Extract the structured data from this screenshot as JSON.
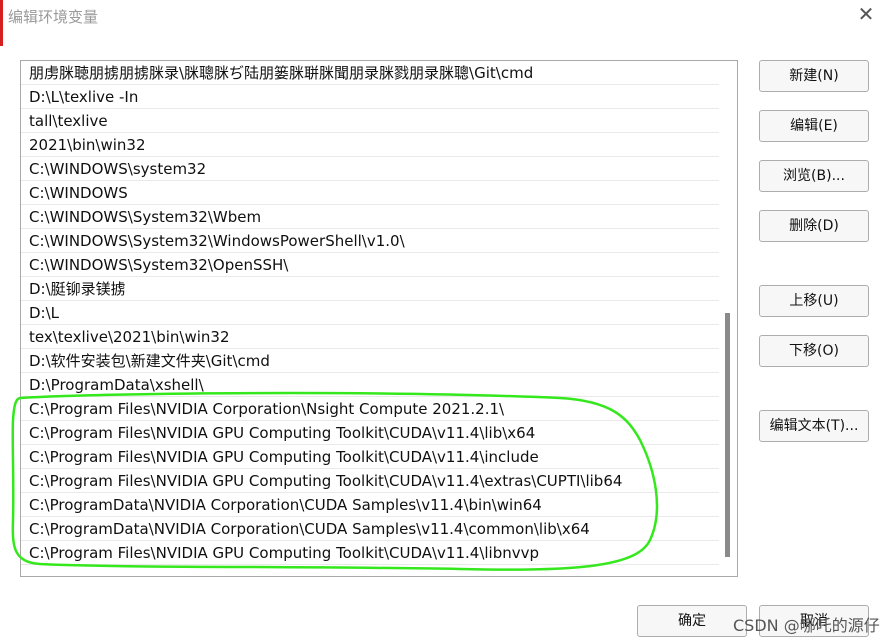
{
  "window": {
    "title": "编辑环境变量",
    "close_glyph": "✕"
  },
  "list": {
    "items": [
      "朋虏脒聴朋掳朋掳脒录\\脒聰脒ぢ陆朋篓脒聠脒聞朋录脒戮朋录脒聰\\Git\\cmd",
      "D:\\L\\texlive -In",
      "tall\\texlive",
      "2021\\bin\\win32",
      "C:\\WINDOWS\\system32",
      "C:\\WINDOWS",
      "C:\\WINDOWS\\System32\\Wbem",
      "C:\\WINDOWS\\System32\\WindowsPowerShell\\v1.0\\",
      "C:\\WINDOWS\\System32\\OpenSSH\\",
      "D:\\脡铆录镁掳",
      "D:\\L",
      "tex\\texlive\\2021\\bin\\win32",
      "D:\\软件安装包\\新建文件夹\\Git\\cmd",
      "D:\\ProgramData\\xshell\\",
      "C:\\Program Files\\NVIDIA Corporation\\Nsight Compute 2021.2.1\\",
      "C:\\Program Files\\NVIDIA GPU Computing Toolkit\\CUDA\\v11.4\\lib\\x64",
      "C:\\Program Files\\NVIDIA GPU Computing Toolkit\\CUDA\\v11.4\\include",
      "C:\\Program Files\\NVIDIA GPU Computing Toolkit\\CUDA\\v11.4\\extras\\CUPTI\\lib64",
      "C:\\ProgramData\\NVIDIA Corporation\\CUDA Samples\\v11.4\\bin\\win64",
      "C:\\ProgramData\\NVIDIA Corporation\\CUDA Samples\\v11.4\\common\\lib\\x64",
      "C:\\Program Files\\NVIDIA GPU Computing Toolkit\\CUDA\\v11.4\\libnvvp"
    ]
  },
  "buttons": {
    "new": "新建(N)",
    "edit": "编辑(E)",
    "browse": "浏览(B)...",
    "delete": "删除(D)",
    "move_up": "上移(U)",
    "move_down": "下移(O)",
    "edit_text": "编辑文本(T)...",
    "ok": "确定",
    "cancel": "取消"
  },
  "watermark": "CSDN @哪吒的源仔",
  "colors": {
    "highlight_stroke": "#35e81d",
    "title_text": "#9a9a9a"
  }
}
